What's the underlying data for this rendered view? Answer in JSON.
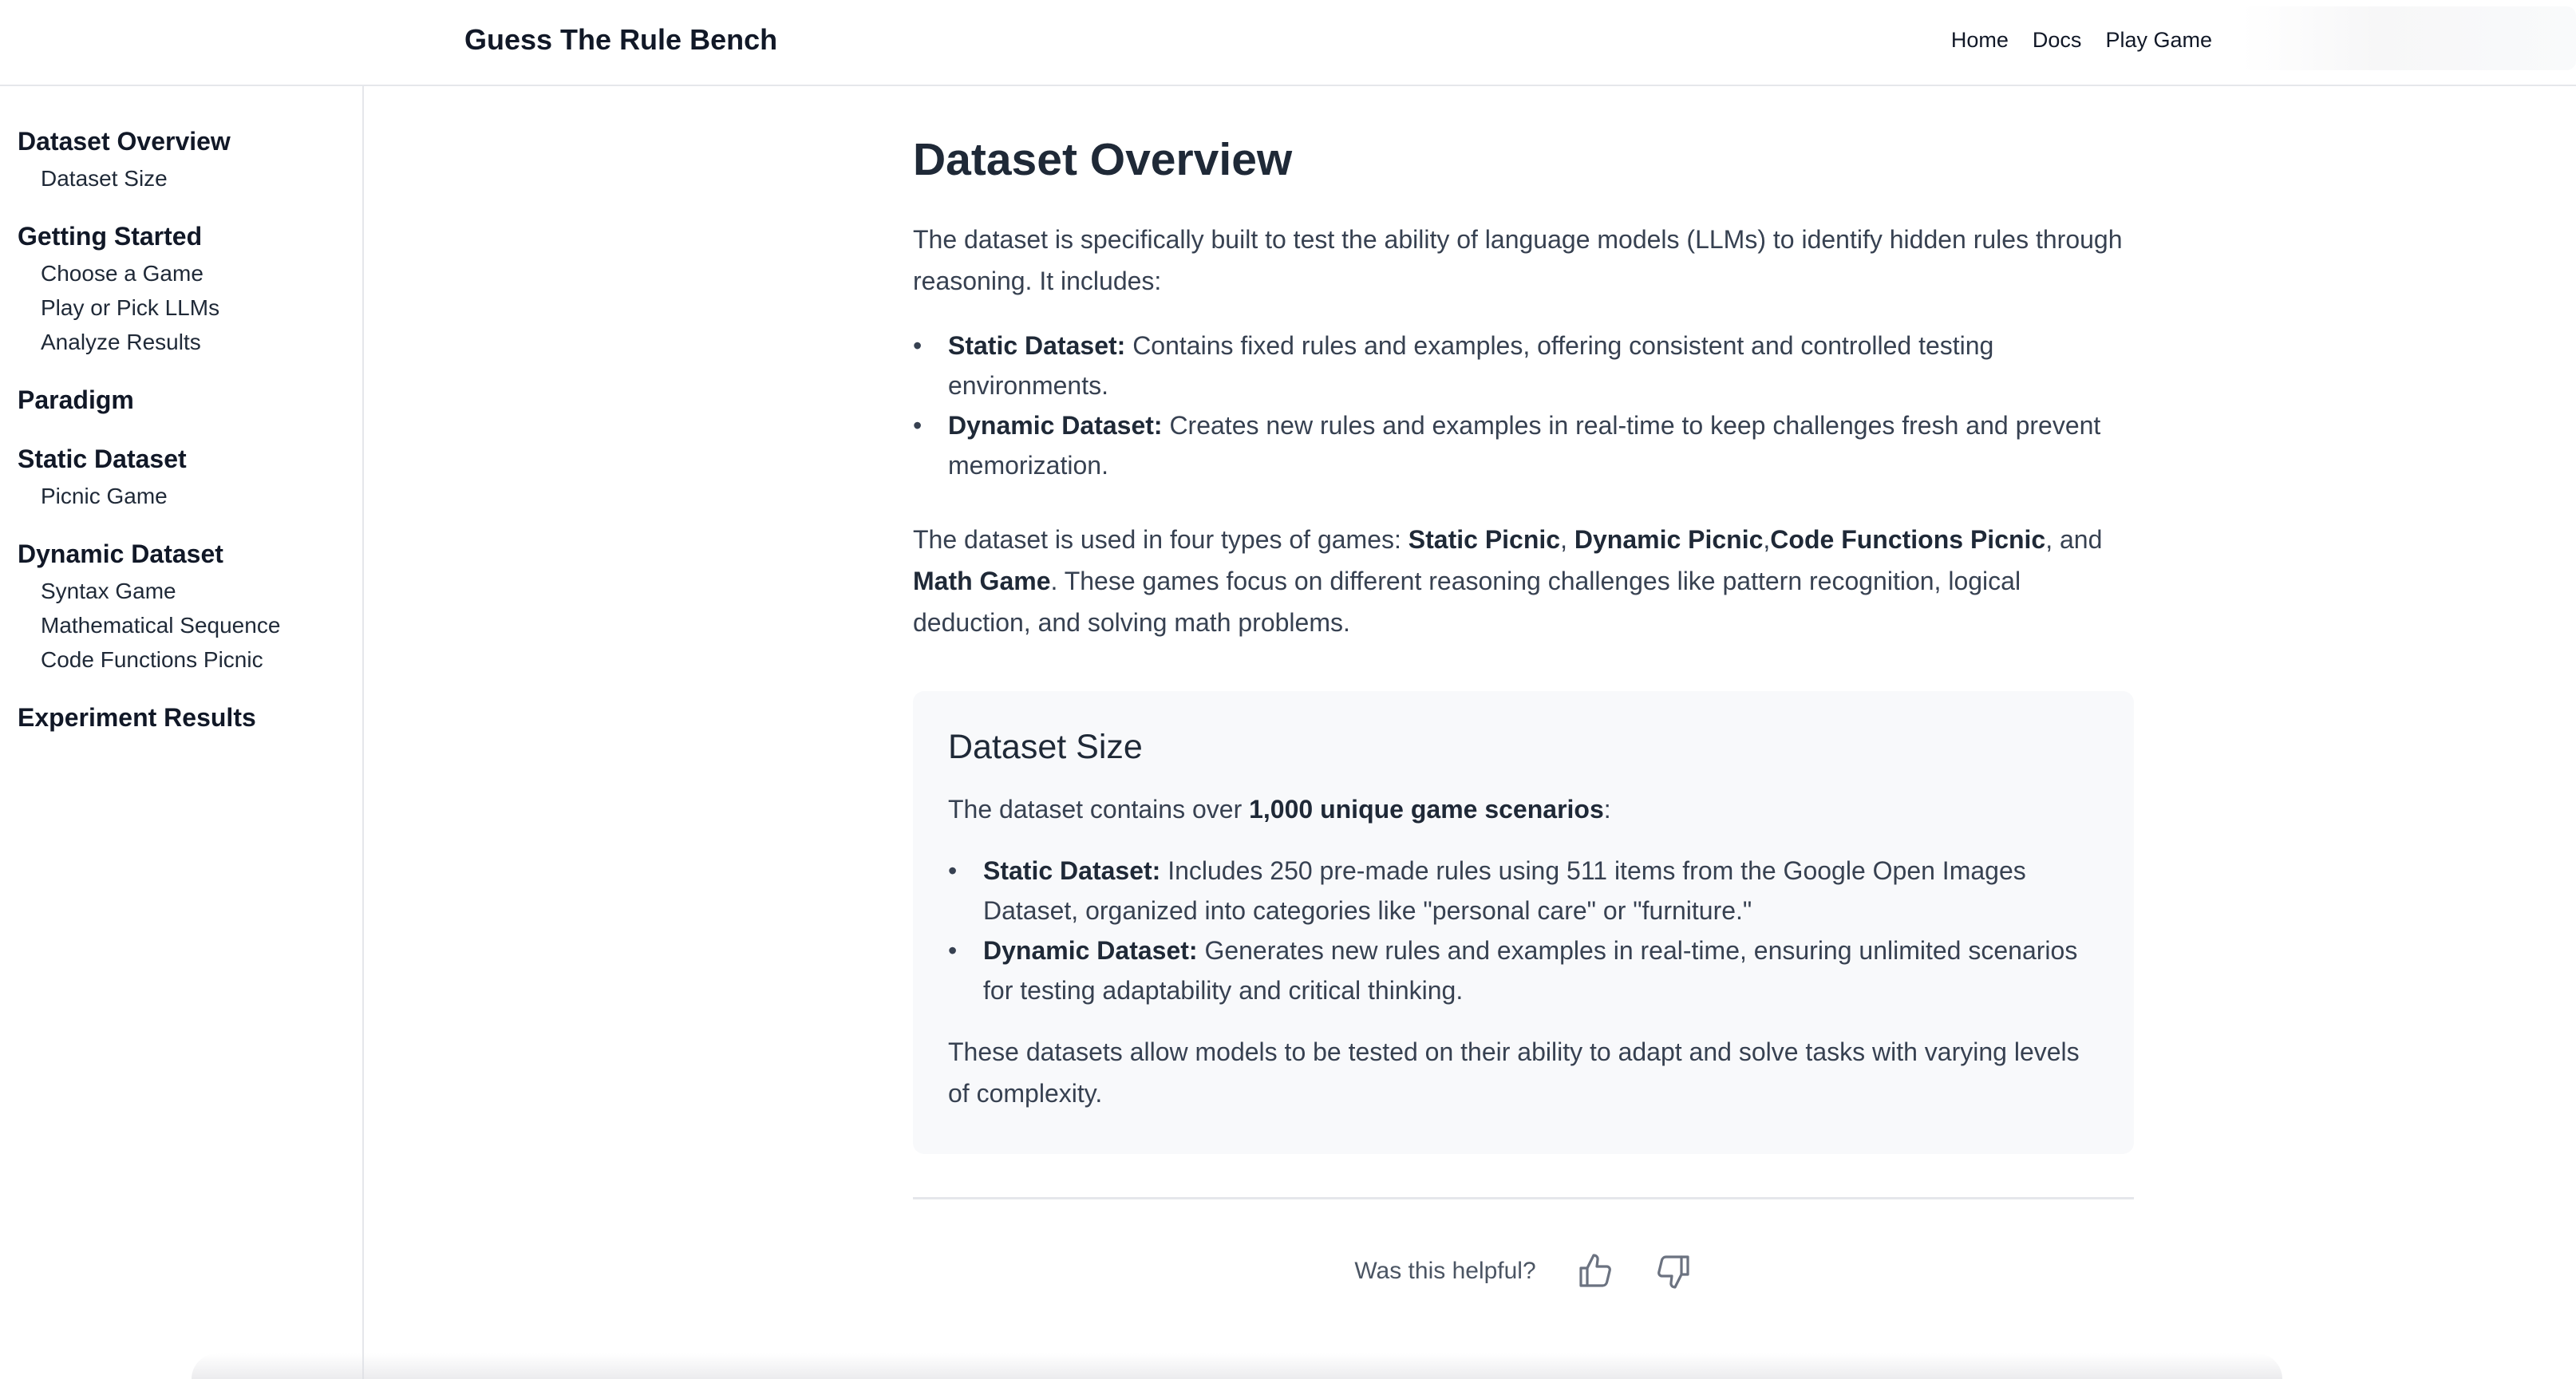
{
  "header": {
    "brand": "Guess The Rule Bench",
    "nav": [
      "Home",
      "Docs",
      "Play Game"
    ]
  },
  "sidebar": {
    "sections": [
      {
        "title": "Dataset Overview",
        "items": [
          "Dataset Size"
        ]
      },
      {
        "title": "Getting Started",
        "items": [
          "Choose a Game",
          "Play or Pick LLMs",
          "Analyze Results"
        ]
      },
      {
        "title": "Paradigm",
        "items": []
      },
      {
        "title": "Static Dataset",
        "items": [
          "Picnic Game"
        ]
      },
      {
        "title": "Dynamic Dataset",
        "items": [
          "Syntax Game",
          "Mathematical Sequence",
          "Code Functions Picnic"
        ]
      },
      {
        "title": "Experiment Results",
        "items": []
      }
    ]
  },
  "main": {
    "title": "Dataset Overview",
    "intro": "The dataset is specifically built to test the ability of language models (LLMs) to identify hidden rules through reasoning. It includes:",
    "bullets": [
      {
        "term": "Static Dataset:",
        "text": " Contains fixed rules and examples, offering consistent and controlled testing environments."
      },
      {
        "term": "Dynamic Dataset:",
        "text": " Creates new rules and examples in real-time to keep challenges fresh and prevent memorization."
      }
    ],
    "games_para": {
      "prefix": "The dataset is used in four types of games: ",
      "g1": "Static Picnic",
      "sep1": ", ",
      "g2": "Dynamic Picnic",
      "sep2": ",",
      "g3": "Code Functions Picnic",
      "sep3": ", and ",
      "g4": "Math Game",
      "suffix": ". These games focus on different reasoning challenges like pattern recognition, logical deduction, and solving math problems."
    },
    "size_card": {
      "title": "Dataset Size",
      "lead_prefix": "The dataset contains over ",
      "lead_bold": "1,000 unique game scenarios",
      "lead_suffix": ":",
      "bullets": [
        {
          "term": "Static Dataset:",
          "text": " Includes 250 pre-made rules using 511 items from the Google Open Images Dataset, organized into categories like \"personal care\" or \"furniture.\""
        },
        {
          "term": "Dynamic Dataset:",
          "text": " Generates new rules and examples in real-time, ensuring unlimited scenarios for testing adaptability and critical thinking."
        }
      ],
      "closing": "These datasets allow models to be tested on their ability to adapt and solve tasks with varying levels of complexity."
    },
    "feedback": {
      "question": "Was this helpful?",
      "icons": [
        "thumbs-up-icon",
        "thumbs-down-icon"
      ]
    }
  }
}
